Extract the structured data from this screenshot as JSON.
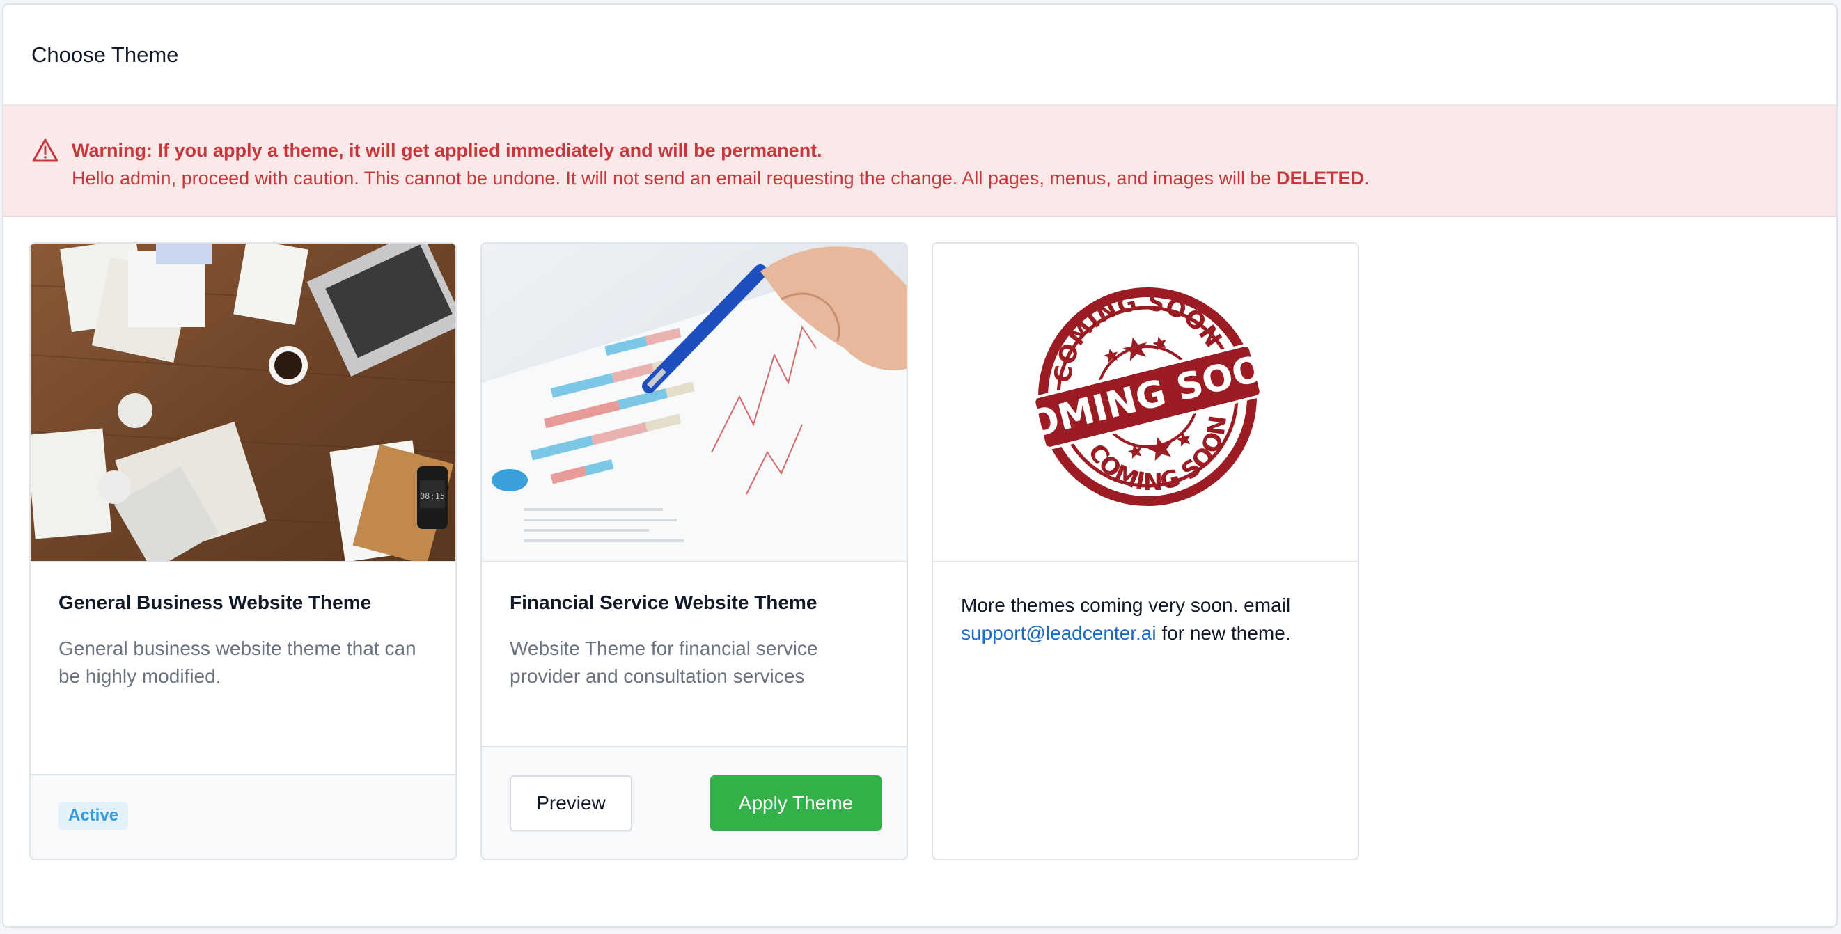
{
  "page": {
    "title": "Choose Theme"
  },
  "warning": {
    "title": "Warning: If you apply a theme, it will get applied immediately and will be permanent.",
    "message": "Hello admin, proceed with caution. This cannot be undone. It will not send an email requesting the change. All pages, menus, and images will be ",
    "emphasis": "DELETED",
    "end": ".",
    "icon": "warning-triangle-icon",
    "color": "#c8373b",
    "background": "#fbe9ea"
  },
  "themes": [
    {
      "name": "General Business Website Theme",
      "description": "General business website theme that can be highly modified.",
      "status": "Active",
      "image": "business-desk-photo"
    },
    {
      "name": "Financial Service Website Theme",
      "description": "Website Theme for financial service provider and consultation services",
      "preview_label": "Preview",
      "apply_label": "Apply Theme",
      "image": "financial-chart-photo"
    }
  ],
  "coming_soon": {
    "stamp_main": "COMING SOON",
    "stamp_top": "COMING SOON",
    "stamp_bottom": "COMING SOON",
    "text_before": "More themes coming very soon. email ",
    "email": "support@leadcenter.ai",
    "text_after": " for new theme."
  },
  "colors": {
    "accent_green": "#33b24a",
    "link_blue": "#1a6bc6",
    "badge_blue": "#3a9ad9",
    "stamp_red": "#9b1c22"
  }
}
